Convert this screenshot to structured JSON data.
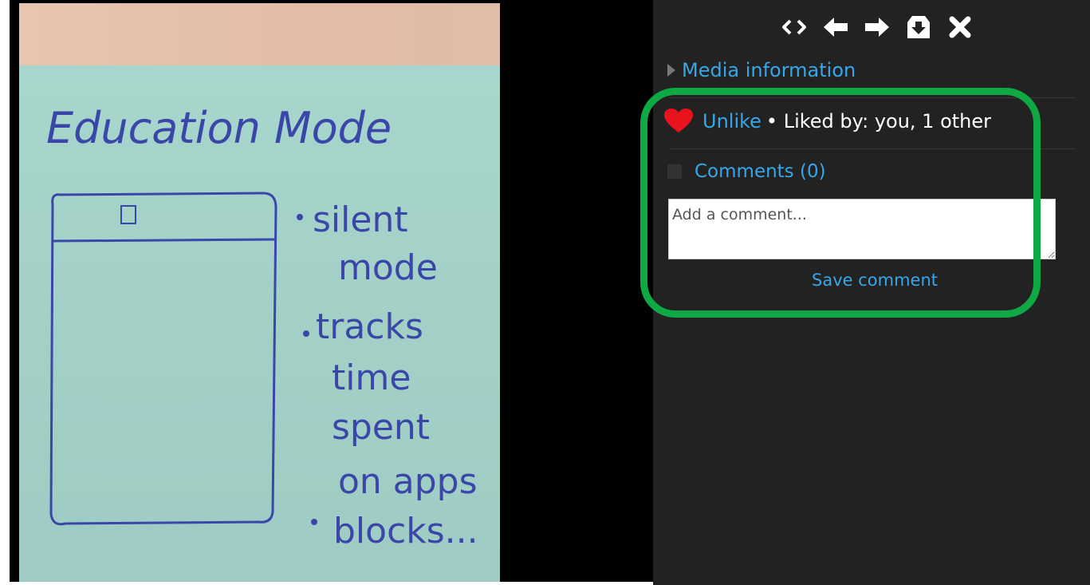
{
  "photo": {
    "title": "Education Mode",
    "bullets": [
      "silent",
      "mode",
      "tracks",
      "time",
      "spent",
      "on apps",
      "blocks..."
    ]
  },
  "toolbar": {
    "icons": [
      "expand-icon",
      "previous-arrow-icon",
      "next-arrow-icon",
      "download-icon",
      "close-icon"
    ]
  },
  "panel": {
    "media_info_label": "Media information",
    "unlike_label": "Unlike",
    "liked_by_text": "• Liked by: you, 1 other",
    "comments_label": "Comments (0)",
    "comment_placeholder": "Add a comment...",
    "save_label": "Save comment"
  },
  "colors": {
    "link": "#36a7e8",
    "highlight": "#0ea945",
    "heart": "#e8131c",
    "panel_bg": "#222222"
  }
}
